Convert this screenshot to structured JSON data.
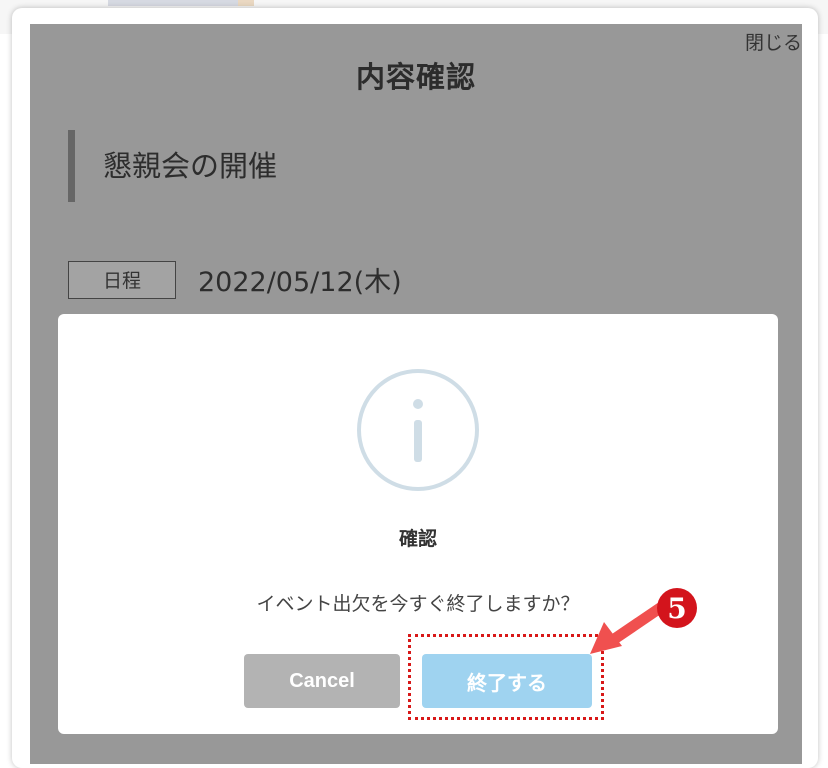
{
  "sheet": {
    "title": "内容確認",
    "close_label": "閉じる",
    "event_title": "懇親会の開催",
    "schedule_label": "日程",
    "schedule_date": "2022/05/12(木)"
  },
  "dialog": {
    "icon": "info-icon",
    "title": "確認",
    "message": "イベント出欠を今すぐ終了しますか？",
    "cancel_label": "Cancel",
    "confirm_label": "終了する"
  },
  "annotation": {
    "step_number": "5",
    "highlight_color": "#d81818"
  },
  "colors": {
    "overlay": "#989898",
    "cancel_button": "#b3b3b3",
    "confirm_button": "#9fd3f0",
    "info_icon_stroke": "#cfdde6"
  }
}
